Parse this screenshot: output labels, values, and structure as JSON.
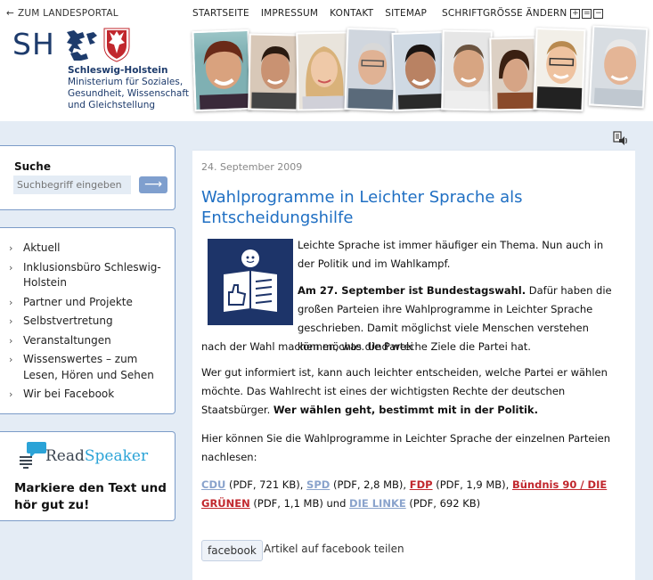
{
  "header": {
    "portal_link": "ZUM LANDESPORTAL",
    "logo_text": "SH",
    "ministry": {
      "state": "Schleswig-Holstein",
      "line1": "Ministerium für Soziales,",
      "line2": "Gesundheit, Wissenschaft",
      "line3": "und Gleichstellung"
    },
    "nav": [
      "STARTSEITE",
      "IMPRESSUM",
      "KONTAKT",
      "SITEMAP"
    ],
    "font_size_label": "SCHRIFTGRÖSSE ÄNDERN",
    "font_size_buttons": [
      "+",
      "=",
      "−"
    ]
  },
  "sidebar": {
    "search": {
      "label": "Suche",
      "placeholder": "Suchbegriff eingeben",
      "button_icon": "arrow-right-icon"
    },
    "nav_items": [
      "Aktuell",
      "Inklusionsbüro Schleswig-Holstein",
      "Partner und Projekte",
      "Selbstvertretung",
      "Veranstaltungen",
      "Wissenswertes – zum Lesen, Hören und Sehen",
      "Wir bei Facebook"
    ],
    "readspeaker": {
      "brand_read": "Read",
      "brand_speaker": "Speaker",
      "tagline_line1": "Markiere den Text und",
      "tagline_line2": "hör gut zu!"
    }
  },
  "article": {
    "date": "24. September 2009",
    "title": "Wahlprogramme in Leichter Sprache als Entscheidungshilfe",
    "p1": "Leichte Sprache ist immer häufiger ein Thema. Nun auch in der Politik und im Wahlkampf.",
    "p2_bold": "Am 27. September ist Bundestagswahl.",
    "p2_rest": " Dafür haben die großen Parteien ihre Wahlprogramme in Leichter Sprache geschrieben. Damit möglichst viele Menschen verstehen können, was die Partei",
    "p2_cont": "nach der Wahl machen möchte. Und welche Ziele die Partei hat.",
    "p3": "Wer gut informiert ist, kann auch leichter entscheiden, welche Partei er wählen möchte. Das Wahlrecht ist eines der wichtigsten Rechte der deutschen Staatsbürger.",
    "p3_bold": "Wer wählen geht, bestimmt mit in der Politik.",
    "p4": "Hier können Sie die Wahlprogramme in Leichter Sprache der einzelnen Parteien nachlesen:",
    "downloads": {
      "cdu": "CDU",
      "cdu_info": " (PDF, 721 KB), ",
      "spd": "SPD",
      "spd_info": " (PDF, 2,8 MB), ",
      "fdp": "FDP",
      "fdp_info": " (PDF, 1,9 MB), ",
      "gruene": "Bündnis 90 / DIE GRÜNEN",
      "gruene_info": " (PDF, 1,1 MB) und ",
      "linke": "DIE LINKE",
      "linke_info": " (PDF, 692 KB)"
    },
    "facebook_button": "facebook",
    "facebook_share": "Artikel auf facebook teilen"
  },
  "colors": {
    "brand_blue": "#1d3b6c",
    "headline_blue": "#1f6fc3",
    "panel_bg": "#e4ecf5",
    "box_border": "#7b9bc8",
    "party_link_gray": "#8aa3cc",
    "party_link_red": "#c1272d",
    "readspeaker_blue": "#2ba3d7"
  }
}
